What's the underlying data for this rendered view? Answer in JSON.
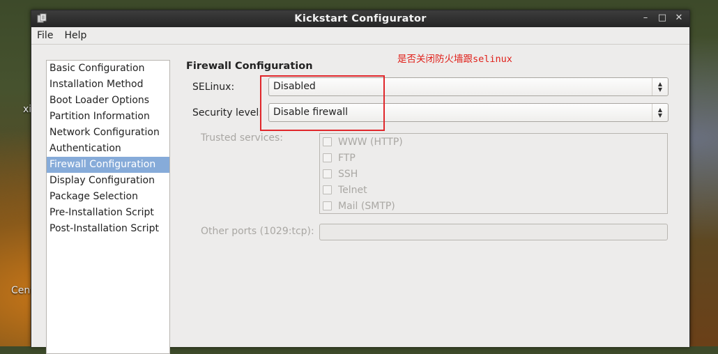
{
  "desktop": {
    "labels": [
      "xi",
      "Cent"
    ]
  },
  "window": {
    "title": "Kickstart Configurator",
    "controls": {
      "minimize": "–",
      "maximize": "□",
      "close": "✕"
    }
  },
  "menubar": {
    "items": [
      "File",
      "Help"
    ]
  },
  "sidebar": {
    "selected_index": 6,
    "items": [
      "Basic Configuration",
      "Installation Method",
      "Boot Loader Options",
      "Partition Information",
      "Network Configuration",
      "Authentication",
      "Firewall Configuration",
      "Display Configuration",
      "Package Selection",
      "Pre-Installation Script",
      "Post-Installation Script"
    ]
  },
  "annotation": {
    "text": "是否关闭防火墙跟selinux",
    "color": "#e0201a"
  },
  "firewall": {
    "section_title": "Firewall Configuration",
    "selinux_label": "SELinux:",
    "selinux_value": "Disabled",
    "security_level_label": "Security level:",
    "security_level_value": "Disable firewall",
    "trusted_services_label": "Trusted services:",
    "trusted_services": [
      {
        "label": "WWW (HTTP)",
        "checked": false
      },
      {
        "label": "FTP",
        "checked": false
      },
      {
        "label": "SSH",
        "checked": false
      },
      {
        "label": "Telnet",
        "checked": false
      },
      {
        "label": "Mail (SMTP)",
        "checked": false
      }
    ],
    "other_ports_label": "Other ports (1029:tcp):",
    "other_ports_value": ""
  },
  "colors": {
    "selection": "#86abd9",
    "annotation_box": "#e0262a"
  }
}
